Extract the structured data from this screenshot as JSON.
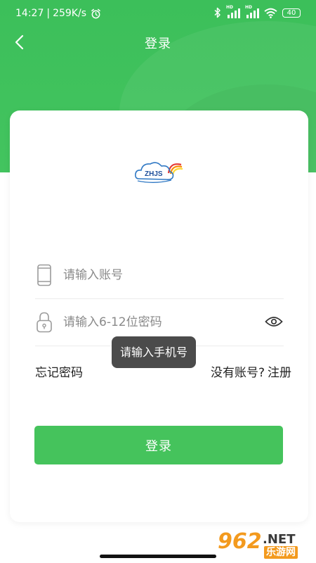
{
  "status_bar": {
    "time": "14:27",
    "separator": "|",
    "net_speed": "259K/s",
    "signal_label_1": "HD",
    "signal_label_2": "HD",
    "battery": "40"
  },
  "nav": {
    "title": "登录"
  },
  "logo": {
    "text": "ZHJS"
  },
  "form": {
    "account_placeholder": "请输入账号",
    "account_value": "",
    "password_placeholder": "请输入6-12位密码",
    "password_value": "",
    "forgot_label": "忘记密码",
    "no_account_label": "没有账号?",
    "register_label": "注册",
    "login_label": "登录"
  },
  "toast": {
    "message": "请输入手机号"
  },
  "watermark": {
    "number": "962",
    "suffix": ".NET",
    "cn": "乐游网"
  },
  "colors": {
    "primary_green": "#45c35c",
    "header_green": "#3cbf5a",
    "toast_bg": "#3c3c3c",
    "watermark_orange": "#f39a1e"
  }
}
